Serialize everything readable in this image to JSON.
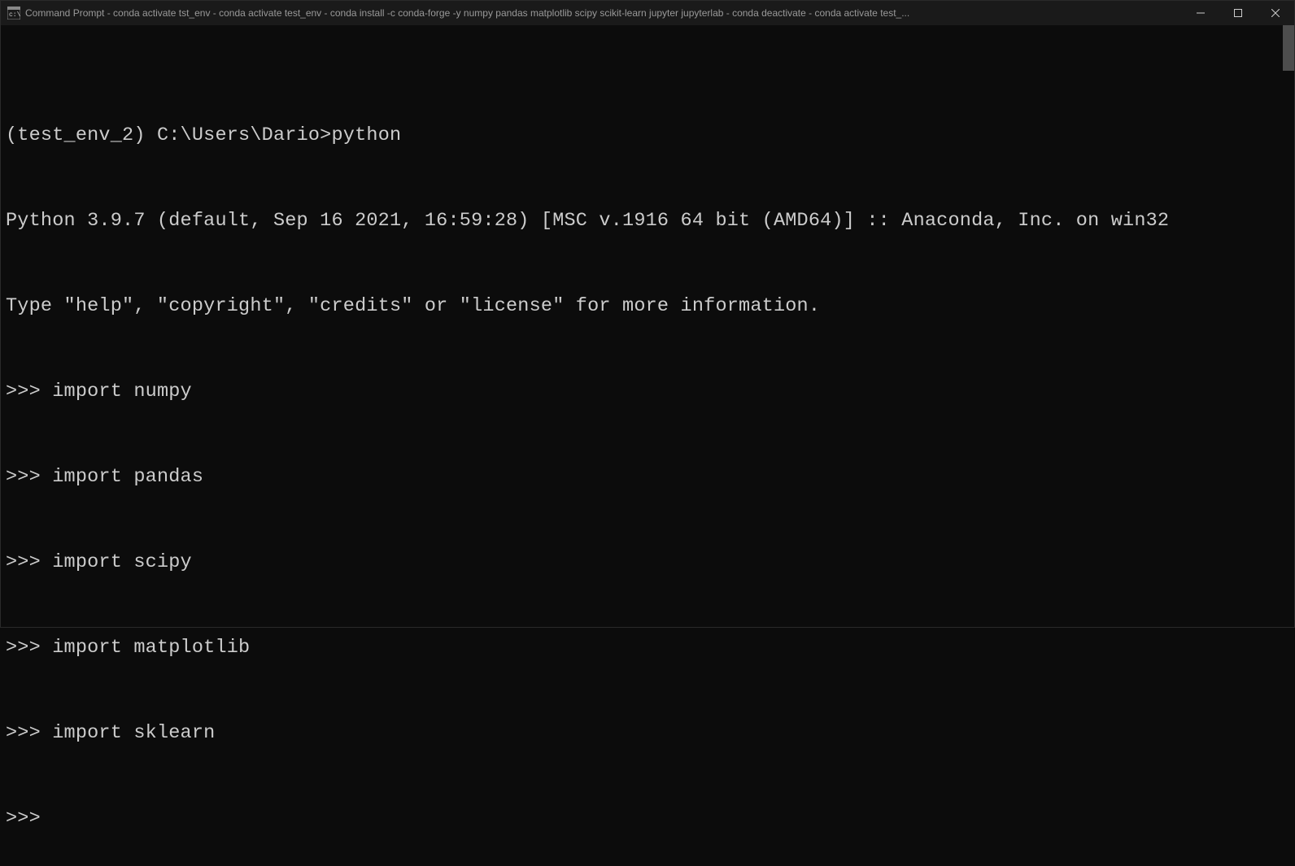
{
  "titlebar": {
    "title": "Command Prompt - conda  activate tst_env - conda  activate test_env - conda  install -c conda-forge -y numpy pandas matplotlib scipy scikit-learn jupyter jupyterlab - conda  deactivate - conda  activate test_..."
  },
  "terminal": {
    "prompt_env": "(test_env_2) ",
    "prompt_path": "C:\\Users\\Dario>",
    "prompt_command": "python",
    "python_banner_line1": "Python 3.9.7 (default, Sep 16 2021, 16:59:28) [MSC v.1916 64 bit (AMD64)] :: Anaconda, Inc. on win32",
    "python_banner_line2": "Type \"help\", \"copyright\", \"credits\" or \"license\" for more information.",
    "repl_prompt": ">>> ",
    "repl_prompt_empty": ">>>",
    "imports": [
      "import numpy",
      "import pandas",
      "import scipy",
      "import matplotlib",
      "import sklearn"
    ]
  }
}
